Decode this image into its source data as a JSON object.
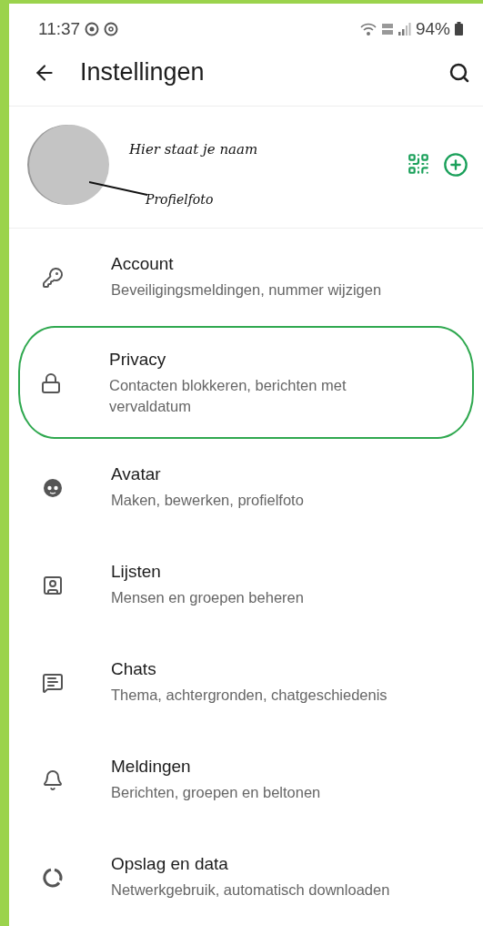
{
  "status_bar": {
    "time": "11:37",
    "battery": "94%"
  },
  "app_bar": {
    "title": "Instellingen"
  },
  "profile": {
    "name": "Hier staat je naam",
    "photo_caption": "Profielfoto"
  },
  "settings": [
    {
      "kind": "key",
      "title": "Account",
      "subtitle": "Beveiligingsmeldingen, nummer wijzigen",
      "highlighted": false
    },
    {
      "kind": "lock",
      "title": "Privacy",
      "subtitle": "Contacten blokkeren, berichten met vervaldatum",
      "highlighted": true
    },
    {
      "kind": "avatar",
      "title": "Avatar",
      "subtitle": "Maken, bewerken, profielfoto",
      "highlighted": false
    },
    {
      "kind": "lists",
      "title": "Lijsten",
      "subtitle": "Mensen en groepen beheren",
      "highlighted": false
    },
    {
      "kind": "chat",
      "title": "Chats",
      "subtitle": "Thema, achtergronden, chatgeschiedenis",
      "highlighted": false
    },
    {
      "kind": "bell",
      "title": "Meldingen",
      "subtitle": "Berichten, groepen en beltonen",
      "highlighted": false
    },
    {
      "kind": "storage",
      "title": "Opslag en data",
      "subtitle": "Netwerkgebruik, automatisch downloaden",
      "highlighted": false
    }
  ]
}
